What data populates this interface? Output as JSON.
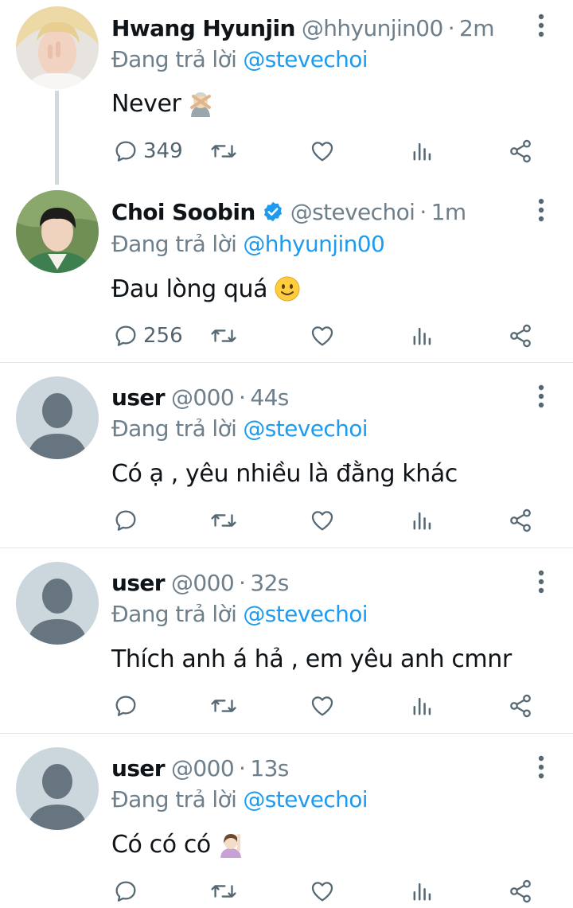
{
  "colors": {
    "accent": "#1d9bf0",
    "muted_text": "#6e7f8c",
    "icon": "#566874",
    "divider": "#e1e6ea",
    "thread_line": "#cfd9de",
    "default_avatar_bg": "#ccd6dd",
    "default_avatar_fg": "#66757f"
  },
  "tweets": [
    {
      "name": "Hwang Hyunjin",
      "handle": "@hhyunjin00",
      "time": "2m",
      "reply_prefix": "Đang trả lời",
      "reply_to": "@stevechoi",
      "text": "Never",
      "emoji": "person-gesturing-no-icon",
      "reply_count": "349",
      "verified": false,
      "avatar": "photo-avatar-blonde"
    },
    {
      "name": "Choi Soobin",
      "handle": "@stevechoi",
      "time": "1m",
      "reply_prefix": "Đang trả lời",
      "reply_to": "@hhyunjin00",
      "text": "Đau lòng quá",
      "emoji": "slightly-smiling-face-icon",
      "reply_count": "256",
      "verified": true,
      "avatar": "photo-avatar-green"
    },
    {
      "name": "user",
      "handle": "@000",
      "time": "44s",
      "reply_prefix": "Đang trả lời",
      "reply_to": "@stevechoi",
      "text": "Có ạ , yêu nhiều là đằng khác",
      "verified": false,
      "avatar": "default-avatar"
    },
    {
      "name": "user",
      "handle": "@000",
      "time": "32s",
      "reply_prefix": "Đang trả lời",
      "reply_to": "@stevechoi",
      "text": "Thích anh á hả , em yêu anh cmnr",
      "verified": false,
      "avatar": "default-avatar"
    },
    {
      "name": "user",
      "handle": "@000",
      "time": "13s",
      "reply_prefix": "Đang trả lời",
      "reply_to": "@stevechoi",
      "text": "Có có có",
      "emoji": "person-raising-hand-icon",
      "verified": false,
      "avatar": "default-avatar"
    }
  ]
}
